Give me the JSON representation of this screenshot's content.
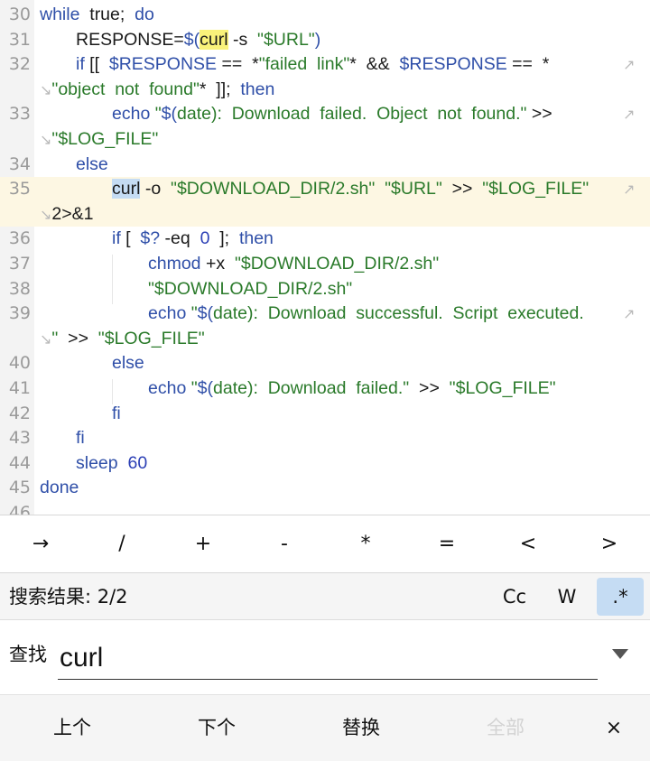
{
  "editor": {
    "lines": [
      {
        "n": "30",
        "indent": 0,
        "segs": [
          [
            "kw",
            "while"
          ],
          [
            "",
            "  true;  "
          ],
          [
            "kw",
            "do"
          ]
        ]
      },
      {
        "n": "31",
        "indent": 1,
        "segs": [
          [
            "",
            "RESPONSE="
          ],
          [
            "dol",
            "$("
          ],
          [
            "hl-yellow",
            "curl"
          ],
          [
            "",
            " -s  "
          ],
          [
            "str",
            "\"$URL\""
          ],
          [
            "dol",
            ")"
          ]
        ]
      },
      {
        "n": "32",
        "indent": 1,
        "wrap": true,
        "segs": [
          [
            "kw",
            "if"
          ],
          [
            "",
            " [[  "
          ],
          [
            "kw",
            "$RESPONSE"
          ],
          [
            "",
            " ==  *"
          ],
          [
            "str",
            "\"failed  link\""
          ],
          [
            "",
            "*  &&  "
          ],
          [
            "kw",
            "$RESPONSE"
          ],
          [
            "",
            " ==  *"
          ]
        ]
      },
      {
        "n": "",
        "indent": 0,
        "cont": true,
        "segs": [
          [
            "str",
            "\"object  not  found\""
          ],
          [
            "",
            "*  ]];  "
          ],
          [
            "kw",
            "then"
          ]
        ]
      },
      {
        "n": "33",
        "indent": 2,
        "wrap": true,
        "segs": [
          [
            "kw",
            "echo"
          ],
          [
            "",
            " "
          ],
          [
            "str",
            "\""
          ],
          [
            "dol",
            "$("
          ],
          [
            "str",
            "date)"
          ],
          [
            "str",
            ":  Download  failed.  Object  not  found.\""
          ],
          [
            "",
            " >> "
          ]
        ]
      },
      {
        "n": "",
        "indent": 0,
        "cont": true,
        "segs": [
          [
            "str",
            "\"$LOG_FILE\""
          ]
        ]
      },
      {
        "n": "34",
        "indent": 1,
        "segs": [
          [
            "kw",
            "else"
          ]
        ]
      },
      {
        "n": "35",
        "indent": 2,
        "wrap": true,
        "current": true,
        "segs": [
          [
            "hl-blue",
            "curl"
          ],
          [
            "",
            " -o  "
          ],
          [
            "str",
            "\"$DOWNLOAD_DIR/2.sh\""
          ],
          [
            "",
            "  "
          ],
          [
            "str",
            "\"$URL\""
          ],
          [
            "",
            "  >>  "
          ],
          [
            "str",
            "\"$LOG_FILE\""
          ]
        ]
      },
      {
        "n": "",
        "indent": 0,
        "cont": true,
        "current": true,
        "segs": [
          [
            "",
            "2>&1"
          ]
        ]
      },
      {
        "n": "36",
        "indent": 2,
        "segs": [
          [
            "kw",
            "if"
          ],
          [
            "",
            " [  "
          ],
          [
            "kw",
            "$?"
          ],
          [
            "",
            " -eq  "
          ],
          [
            "num",
            "0"
          ],
          [
            "",
            "  ];  "
          ],
          [
            "kw",
            "then"
          ]
        ]
      },
      {
        "n": "37",
        "indent": 3,
        "segs": [
          [
            "kw",
            "chmod"
          ],
          [
            "",
            " +x  "
          ],
          [
            "str",
            "\"$DOWNLOAD_DIR/2.sh\""
          ]
        ]
      },
      {
        "n": "38",
        "indent": 3,
        "segs": [
          [
            "str",
            "\"$DOWNLOAD_DIR/2.sh\""
          ]
        ]
      },
      {
        "n": "39",
        "indent": 3,
        "wrap": true,
        "segs": [
          [
            "kw",
            "echo"
          ],
          [
            "",
            " "
          ],
          [
            "str",
            "\""
          ],
          [
            "dol",
            "$("
          ],
          [
            "str",
            "date):  Download  successful.  Script  executed."
          ]
        ]
      },
      {
        "n": "",
        "indent": 0,
        "cont": true,
        "segs": [
          [
            "str",
            "\""
          ],
          [
            "",
            "  >>  "
          ],
          [
            "str",
            "\"$LOG_FILE\""
          ]
        ]
      },
      {
        "n": "40",
        "indent": 2,
        "segs": [
          [
            "kw",
            "else"
          ]
        ]
      },
      {
        "n": "41",
        "indent": 3,
        "segs": [
          [
            "kw",
            "echo"
          ],
          [
            "",
            " "
          ],
          [
            "str",
            "\""
          ],
          [
            "dol",
            "$("
          ],
          [
            "str",
            "date):  Download  failed.\""
          ],
          [
            "",
            "  >>  "
          ],
          [
            "str",
            "\"$LOG_FILE\""
          ]
        ]
      },
      {
        "n": "42",
        "indent": 2,
        "segs": [
          [
            "kw",
            "fi"
          ]
        ]
      },
      {
        "n": "43",
        "indent": 1,
        "segs": [
          [
            "kw",
            "fi"
          ]
        ]
      },
      {
        "n": "44",
        "indent": 1,
        "segs": [
          [
            "kw",
            "sleep"
          ],
          [
            "",
            "  "
          ],
          [
            "num",
            "60"
          ]
        ]
      },
      {
        "n": "45",
        "indent": 0,
        "segs": [
          [
            "kw",
            "done"
          ]
        ]
      },
      {
        "n": "46",
        "indent": 0,
        "segs": []
      }
    ]
  },
  "symbols": [
    "→",
    "/",
    "+",
    "-",
    "*",
    "=",
    "<",
    ">"
  ],
  "search": {
    "result_label": "搜索结果: 2/2",
    "options": {
      "case_label": "Cc",
      "word_label": "W",
      "regex_label": ".*",
      "regex_active": true
    },
    "find_label": "查找",
    "find_value": "curl"
  },
  "actions": {
    "prev_label": "上个",
    "next_label": "下个",
    "replace_label": "替换",
    "all_label": "全部",
    "all_disabled": true,
    "close_label": "×"
  },
  "colors": {
    "keyword": "#2f4fa8",
    "string": "#2a7a2a",
    "number": "#2b3fb5",
    "current_line": "#fdf7e3",
    "match_current": "#f9f27a",
    "match_other": "#c5dcf3",
    "toggle_active": "#c5dcf3"
  }
}
